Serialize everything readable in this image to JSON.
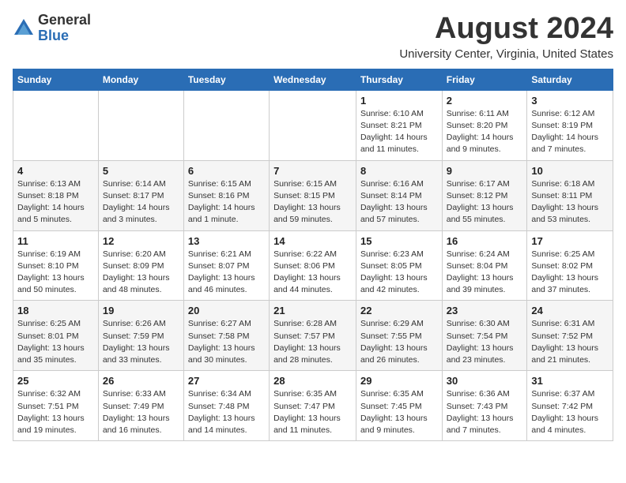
{
  "logo": {
    "general": "General",
    "blue": "Blue"
  },
  "title": "August 2024",
  "location": "University Center, Virginia, United States",
  "days_of_week": [
    "Sunday",
    "Monday",
    "Tuesday",
    "Wednesday",
    "Thursday",
    "Friday",
    "Saturday"
  ],
  "weeks": [
    [
      {
        "day": "",
        "info": ""
      },
      {
        "day": "",
        "info": ""
      },
      {
        "day": "",
        "info": ""
      },
      {
        "day": "",
        "info": ""
      },
      {
        "day": "1",
        "info": "Sunrise: 6:10 AM\nSunset: 8:21 PM\nDaylight: 14 hours\nand 11 minutes."
      },
      {
        "day": "2",
        "info": "Sunrise: 6:11 AM\nSunset: 8:20 PM\nDaylight: 14 hours\nand 9 minutes."
      },
      {
        "day": "3",
        "info": "Sunrise: 6:12 AM\nSunset: 8:19 PM\nDaylight: 14 hours\nand 7 minutes."
      }
    ],
    [
      {
        "day": "4",
        "info": "Sunrise: 6:13 AM\nSunset: 8:18 PM\nDaylight: 14 hours\nand 5 minutes."
      },
      {
        "day": "5",
        "info": "Sunrise: 6:14 AM\nSunset: 8:17 PM\nDaylight: 14 hours\nand 3 minutes."
      },
      {
        "day": "6",
        "info": "Sunrise: 6:15 AM\nSunset: 8:16 PM\nDaylight: 14 hours\nand 1 minute."
      },
      {
        "day": "7",
        "info": "Sunrise: 6:15 AM\nSunset: 8:15 PM\nDaylight: 13 hours\nand 59 minutes."
      },
      {
        "day": "8",
        "info": "Sunrise: 6:16 AM\nSunset: 8:14 PM\nDaylight: 13 hours\nand 57 minutes."
      },
      {
        "day": "9",
        "info": "Sunrise: 6:17 AM\nSunset: 8:12 PM\nDaylight: 13 hours\nand 55 minutes."
      },
      {
        "day": "10",
        "info": "Sunrise: 6:18 AM\nSunset: 8:11 PM\nDaylight: 13 hours\nand 53 minutes."
      }
    ],
    [
      {
        "day": "11",
        "info": "Sunrise: 6:19 AM\nSunset: 8:10 PM\nDaylight: 13 hours\nand 50 minutes."
      },
      {
        "day": "12",
        "info": "Sunrise: 6:20 AM\nSunset: 8:09 PM\nDaylight: 13 hours\nand 48 minutes."
      },
      {
        "day": "13",
        "info": "Sunrise: 6:21 AM\nSunset: 8:07 PM\nDaylight: 13 hours\nand 46 minutes."
      },
      {
        "day": "14",
        "info": "Sunrise: 6:22 AM\nSunset: 8:06 PM\nDaylight: 13 hours\nand 44 minutes."
      },
      {
        "day": "15",
        "info": "Sunrise: 6:23 AM\nSunset: 8:05 PM\nDaylight: 13 hours\nand 42 minutes."
      },
      {
        "day": "16",
        "info": "Sunrise: 6:24 AM\nSunset: 8:04 PM\nDaylight: 13 hours\nand 39 minutes."
      },
      {
        "day": "17",
        "info": "Sunrise: 6:25 AM\nSunset: 8:02 PM\nDaylight: 13 hours\nand 37 minutes."
      }
    ],
    [
      {
        "day": "18",
        "info": "Sunrise: 6:25 AM\nSunset: 8:01 PM\nDaylight: 13 hours\nand 35 minutes."
      },
      {
        "day": "19",
        "info": "Sunrise: 6:26 AM\nSunset: 7:59 PM\nDaylight: 13 hours\nand 33 minutes."
      },
      {
        "day": "20",
        "info": "Sunrise: 6:27 AM\nSunset: 7:58 PM\nDaylight: 13 hours\nand 30 minutes."
      },
      {
        "day": "21",
        "info": "Sunrise: 6:28 AM\nSunset: 7:57 PM\nDaylight: 13 hours\nand 28 minutes."
      },
      {
        "day": "22",
        "info": "Sunrise: 6:29 AM\nSunset: 7:55 PM\nDaylight: 13 hours\nand 26 minutes."
      },
      {
        "day": "23",
        "info": "Sunrise: 6:30 AM\nSunset: 7:54 PM\nDaylight: 13 hours\nand 23 minutes."
      },
      {
        "day": "24",
        "info": "Sunrise: 6:31 AM\nSunset: 7:52 PM\nDaylight: 13 hours\nand 21 minutes."
      }
    ],
    [
      {
        "day": "25",
        "info": "Sunrise: 6:32 AM\nSunset: 7:51 PM\nDaylight: 13 hours\nand 19 minutes."
      },
      {
        "day": "26",
        "info": "Sunrise: 6:33 AM\nSunset: 7:49 PM\nDaylight: 13 hours\nand 16 minutes."
      },
      {
        "day": "27",
        "info": "Sunrise: 6:34 AM\nSunset: 7:48 PM\nDaylight: 13 hours\nand 14 minutes."
      },
      {
        "day": "28",
        "info": "Sunrise: 6:35 AM\nSunset: 7:47 PM\nDaylight: 13 hours\nand 11 minutes."
      },
      {
        "day": "29",
        "info": "Sunrise: 6:35 AM\nSunset: 7:45 PM\nDaylight: 13 hours\nand 9 minutes."
      },
      {
        "day": "30",
        "info": "Sunrise: 6:36 AM\nSunset: 7:43 PM\nDaylight: 13 hours\nand 7 minutes."
      },
      {
        "day": "31",
        "info": "Sunrise: 6:37 AM\nSunset: 7:42 PM\nDaylight: 13 hours\nand 4 minutes."
      }
    ]
  ]
}
